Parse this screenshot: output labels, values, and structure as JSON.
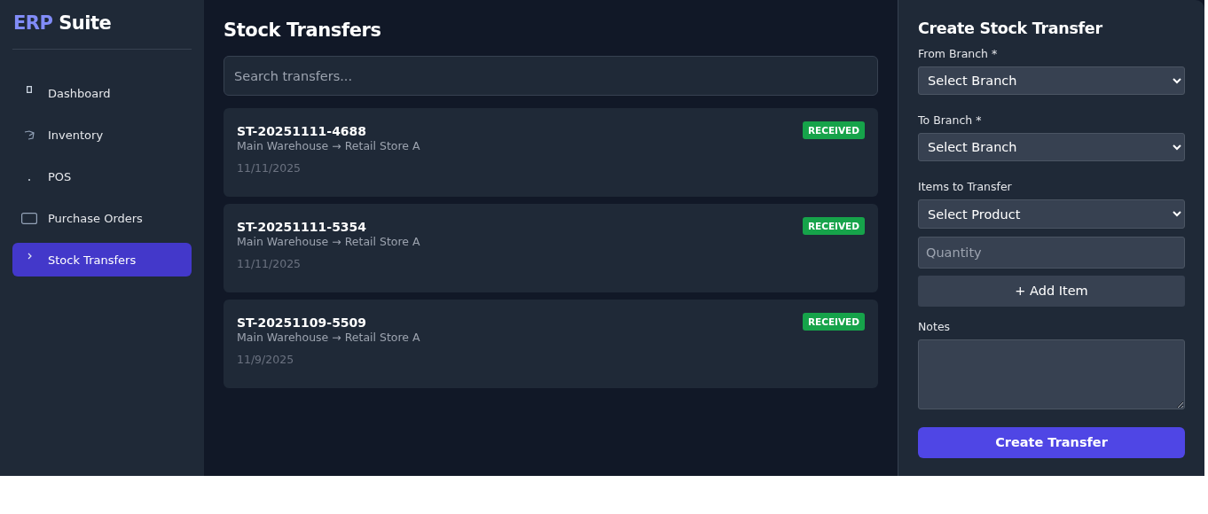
{
  "logo": {
    "accent": "ERP",
    "text": "Suite"
  },
  "sidebar": {
    "items": [
      {
        "label": "Dashboard",
        "selected": false
      },
      {
        "label": "Inventory",
        "selected": false
      },
      {
        "label": "POS",
        "selected": false
      },
      {
        "label": "Purchase Orders",
        "selected": false
      },
      {
        "label": "Stock Transfers",
        "selected": true
      }
    ]
  },
  "main": {
    "title": "Stock Transfers",
    "search": {
      "placeholder": "Search transfers..."
    },
    "transfers": [
      {
        "id": "ST-20251111-4688",
        "route": "Main Warehouse → Retail Store A",
        "date": "11/11/2025",
        "status": "RECEIVED",
        "color": "#16a34a"
      },
      {
        "id": "ST-20251111-5354",
        "route": "Main Warehouse → Retail Store A",
        "date": "11/11/2025",
        "status": "RECEIVED",
        "color": "#16a34a"
      },
      {
        "id": "ST-20251109-5509",
        "route": "Main Warehouse → Retail Store A",
        "date": "11/9/2025",
        "status": "RECEIVED",
        "color": "#16a34a"
      }
    ]
  },
  "form": {
    "title": "Create Stock Transfer",
    "fields": [
      {
        "kind": "label",
        "text": "From Branch *"
      },
      {
        "kind": "select",
        "value": "Select Branch"
      },
      {
        "kind": "label",
        "text": "To Branch *"
      },
      {
        "kind": "select",
        "value": "Select Branch"
      },
      {
        "kind": "label",
        "text": "Items to Transfer"
      },
      {
        "kind": "select",
        "value": "Select Product"
      },
      {
        "kind": "input",
        "placeholder": "Quantity"
      },
      {
        "kind": "button",
        "text": "+ Add Item"
      },
      {
        "kind": "label",
        "text": "Notes"
      },
      {
        "kind": "textarea"
      }
    ],
    "submit": "Create Transfer"
  }
}
